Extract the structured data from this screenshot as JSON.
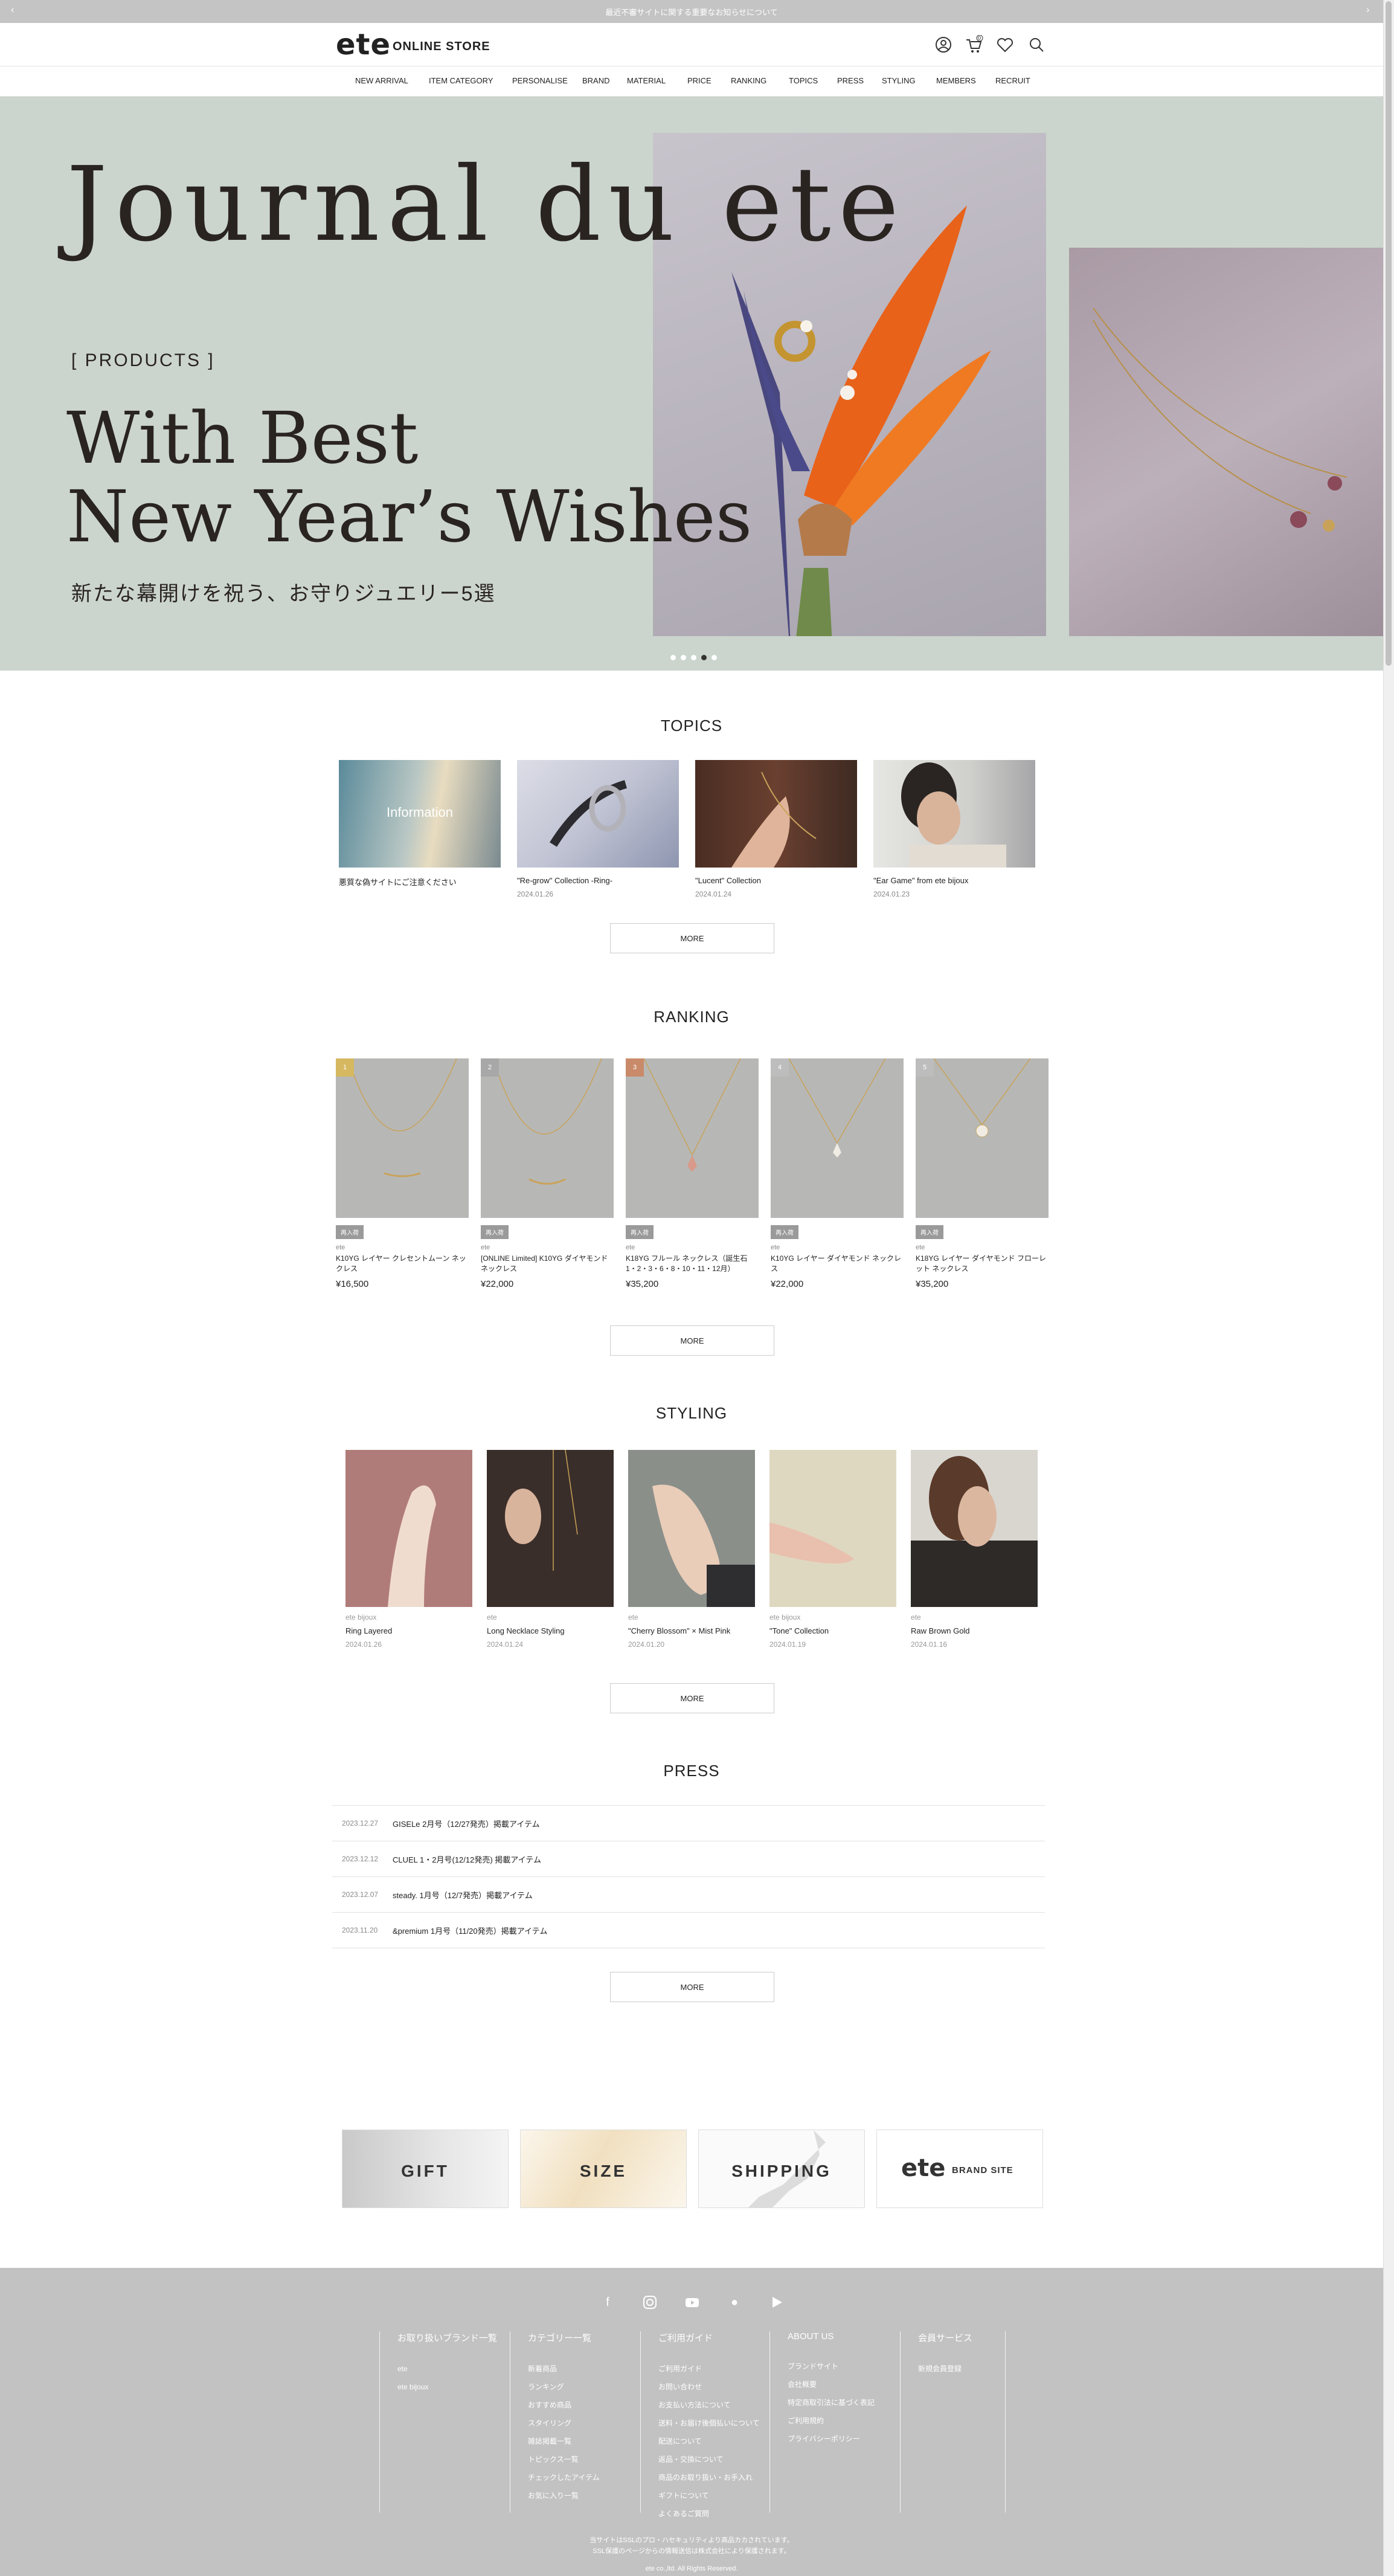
{
  "announcement": {
    "text": "最近不審サイトに関する重要なお知らせについて",
    "prev": "‹",
    "next": "›"
  },
  "header": {
    "logo": "ete",
    "store": "ONLINE STORE",
    "icons": [
      "account-icon",
      "cart-icon",
      "favorite-icon",
      "search-icon"
    ],
    "cart_count": "0"
  },
  "nav": [
    "NEW ARRIVAL",
    "ITEM CATEGORY",
    "PERSONALISE",
    "BRAND",
    "MATERIAL",
    "PRICE",
    "RANKING",
    "TOPICS",
    "PRESS",
    "STYLING",
    "MEMBERS",
    "RECRUIT"
  ],
  "hero": {
    "title": "Journal du ete",
    "tag": "[ PRODUCTS ]",
    "headline1": "With Best",
    "headline2": "New Year’s Wishes",
    "subtitle": "新たな幕開けを祝う、お守りジュエリー5選",
    "slide_count": 5,
    "active_slide": 4
  },
  "topics": {
    "title": "TOPICS",
    "more": "MORE",
    "items": [
      {
        "title": "悪質な偽サイトにご注意ください",
        "date": "",
        "overlay": "Information"
      },
      {
        "title": "\"Re-grow\" Collection -Ring-",
        "date": "2024.01.26",
        "overlay": ""
      },
      {
        "title": "\"Lucent\" Collection",
        "date": "2024.01.24",
        "overlay": ""
      },
      {
        "title": "\"Ear Game\" from ete bijoux",
        "date": "2024.01.23",
        "overlay": ""
      }
    ]
  },
  "ranking": {
    "title": "RANKING",
    "more": "MORE",
    "items": [
      {
        "rank": "1",
        "tag": "再入荷",
        "brand": "ete",
        "name": "K10YG レイヤー クレセントムーン ネックレス",
        "price": "¥16,500",
        "badge_color": "#d6b860"
      },
      {
        "rank": "2",
        "tag": "再入荷",
        "brand": "ete",
        "name": "[ONLINE Limited] K10YG ダイヤモンド ネックレス",
        "price": "¥22,000",
        "badge_color": "#a8a8a8"
      },
      {
        "rank": "3",
        "tag": "再入荷",
        "brand": "ete",
        "name": "K18YG フルール ネックレス（誕生石1・2・3・6・8・10・11・12月）",
        "price": "¥35,200",
        "badge_color": "#c98a6a"
      },
      {
        "rank": "4",
        "tag": "再入荷",
        "brand": "ete",
        "name": "K10YG レイヤー ダイヤモンド ネックレス",
        "price": "¥22,000",
        "badge_color": "#bdbdbd"
      },
      {
        "rank": "5",
        "tag": "再入荷",
        "brand": "ete",
        "name": "K18YG レイヤー ダイヤモンド フローレット ネックレス",
        "price": "¥35,200",
        "badge_color": "#bdbdbd"
      }
    ]
  },
  "styling": {
    "title": "STYLING",
    "more": "MORE",
    "items": [
      {
        "brand": "ete bijoux",
        "name": "Ring Layered",
        "date": "2024.01.26"
      },
      {
        "brand": "ete",
        "name": "Long Necklace Styling",
        "date": "2024.01.24"
      },
      {
        "brand": "ete",
        "name": "\"Cherry Blossom\" × Mist Pink",
        "date": "2024.01.20"
      },
      {
        "brand": "ete bijoux",
        "name": "\"Tone\" Collection",
        "date": "2024.01.19"
      },
      {
        "brand": "ete",
        "name": "Raw Brown Gold",
        "date": "2024.01.16"
      }
    ]
  },
  "press": {
    "title": "PRESS",
    "more": "MORE",
    "items": [
      {
        "date": "2023.12.27",
        "title": "GISELe 2月号（12/27発売）掲載アイテム"
      },
      {
        "date": "2023.12.12",
        "title": "CLUEL 1・2月号(12/12発売) 掲載アイテム"
      },
      {
        "date": "2023.12.07",
        "title": "steady. 1月号（12/7発売）掲載アイテム"
      },
      {
        "date": "2023.11.20",
        "title": "&premium 1月号（11/20発売）掲載アイテム"
      }
    ]
  },
  "banners": [
    {
      "label": "GIFT"
    },
    {
      "label": "SIZE"
    },
    {
      "label": "SHIPPING"
    },
    {
      "label": "ete",
      "sub": "BRAND SITE"
    }
  ],
  "footer": {
    "social": [
      "facebook-icon",
      "instagram-icon",
      "youtube-icon",
      "apple-icon",
      "play-icon"
    ],
    "columns": [
      {
        "title": "お取り扱いブランド一覧",
        "items": [
          "ete",
          "ete bijoux"
        ]
      },
      {
        "title": "カテゴリー一覧",
        "items": [
          "新着商品",
          "ランキング",
          "おすすめ商品",
          "スタイリング",
          "雑誌掲載一覧",
          "トピックス一覧",
          "チェックしたアイテム",
          "お気に入り一覧"
        ]
      },
      {
        "title": "ご利用ガイド",
        "items": [
          "ご利用ガイド",
          "お問い合わせ",
          "お支払い方法について",
          "送料・お届け後個払いについて",
          "配送について",
          "返品・交換について",
          "商品のお取り扱い・お手入れ",
          "ギフトについて",
          "よくあるご質問"
        ]
      },
      {
        "title": "ABOUT US",
        "items": [
          "ブランドサイト",
          "会社概要",
          "特定商取引法に基づく表記",
          "ご利用規約",
          "プライバシーポリシー"
        ]
      },
      {
        "title": "会員サービス",
        "items": [
          "新規会員登録"
        ]
      }
    ],
    "note1": "当サイトはSSLのプロ・ハセキュリティより高品カカされています。",
    "note2": "SSL保護のページからの情報送信は株式会社により保護されます。",
    "copyright": "ete co.,ltd. All Rights Reserved."
  },
  "colors": {
    "hero_bg": "#cbd5cd",
    "footer_bg": "#c2c2c2",
    "topbar_bg": "#c4c4c4"
  }
}
